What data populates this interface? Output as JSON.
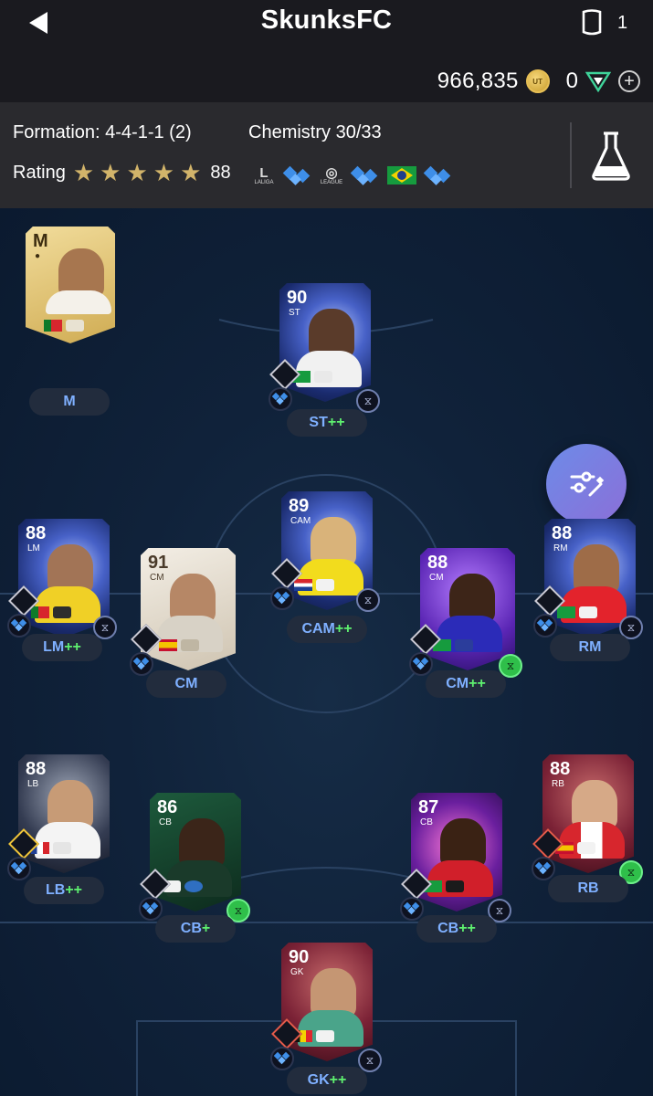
{
  "header": {
    "title": "SkunksFC",
    "squad_count": "1",
    "coins": "966,835",
    "coin_icon_text": "UT",
    "points": "0",
    "icons": [
      "back-arrow-icon",
      "squad-card-icon",
      "coin-icon",
      "fc-points-icon",
      "plus-icon"
    ]
  },
  "info": {
    "formation": "Formation: 4-4-1-1 (2)",
    "chemistry": "Chemistry 30/33",
    "rating_label": "Rating",
    "rating_value": "88",
    "stars": 5,
    "leagues": [
      {
        "name": "LALIGA",
        "mark": "L"
      },
      {
        "name": "LEAGUE",
        "mark": "◎"
      }
    ],
    "lab_icon": "flask-icon"
  },
  "colors": {
    "accent_blue": "#7fb0ff",
    "plus_green": "#5ef06f",
    "star_gold": "#d2b46a",
    "fab_gradient": [
      "#6d8be8",
      "#8b6fd8"
    ]
  },
  "pitch": {
    "manager": {
      "rating": "M",
      "position_label": "M"
    },
    "players": [
      {
        "id": "st",
        "rating": "90",
        "pos": "ST",
        "tag": "ST",
        "plus": "++"
      },
      {
        "id": "lm",
        "rating": "88",
        "pos": "LM",
        "tag": "LM",
        "plus": "++"
      },
      {
        "id": "cam",
        "rating": "89",
        "pos": "CAM",
        "tag": "CAM",
        "plus": "++"
      },
      {
        "id": "rm",
        "rating": "88",
        "pos": "RM",
        "tag": "RM",
        "plus": ""
      },
      {
        "id": "cm1",
        "rating": "91",
        "pos": "CM",
        "tag": "CM",
        "plus": ""
      },
      {
        "id": "cm2",
        "rating": "88",
        "pos": "CM",
        "tag": "CM",
        "plus": "++"
      },
      {
        "id": "lb",
        "rating": "88",
        "pos": "LB",
        "tag": "LB",
        "plus": "++"
      },
      {
        "id": "cb1",
        "rating": "86",
        "pos": "CB",
        "tag": "CB",
        "plus": "+"
      },
      {
        "id": "cb2",
        "rating": "87",
        "pos": "CB",
        "tag": "CB",
        "plus": "++"
      },
      {
        "id": "rb",
        "rating": "88",
        "pos": "RB",
        "tag": "RB",
        "plus": ""
      },
      {
        "id": "gk",
        "rating": "90",
        "pos": "GK",
        "tag": "GK",
        "plus": "++"
      }
    ]
  }
}
